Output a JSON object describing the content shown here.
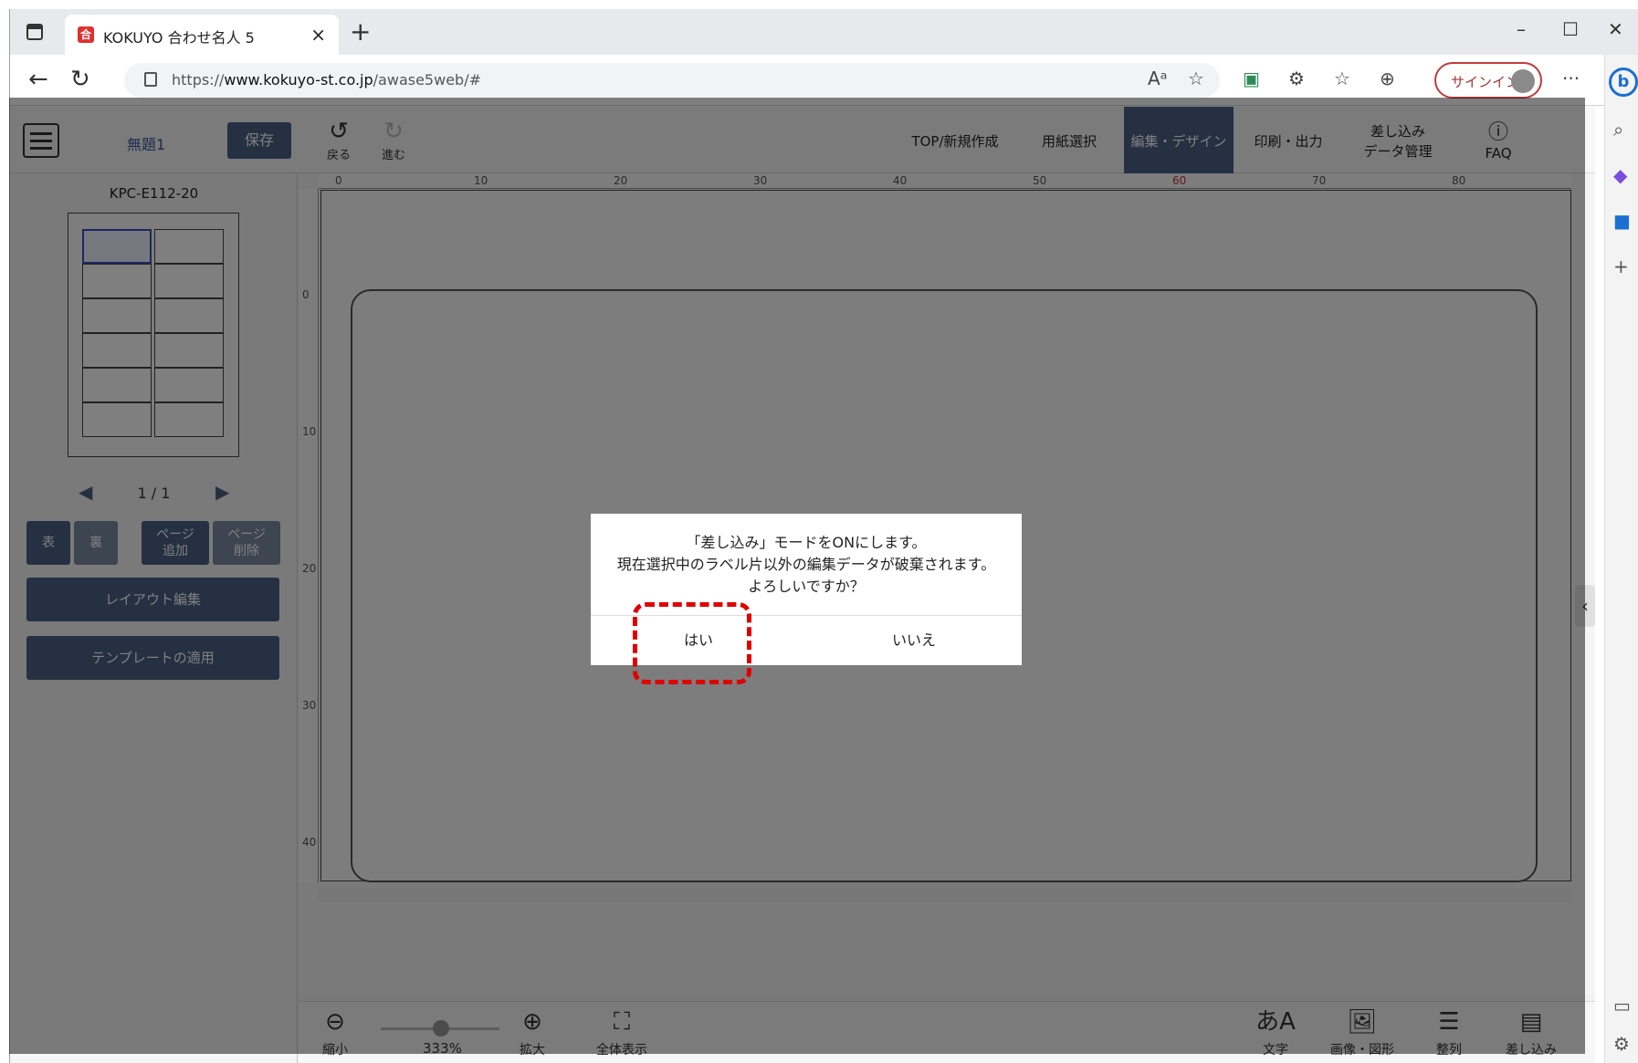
{
  "browser": {
    "tab_title": "KOKUYO 合わせ名人 5",
    "url_prefix": "https://",
    "url_host": "www.kokuyo-st.co.jp",
    "url_path": "/awase5web/#",
    "signin_label": "サインイン"
  },
  "app": {
    "doc_title": "無題1",
    "save_label": "保存",
    "undo_label": "戻る",
    "redo_label": "進む",
    "nav": [
      {
        "label": "TOP/新規作成"
      },
      {
        "label": "用紙選択"
      },
      {
        "label": "編集・デザイン"
      },
      {
        "label": "印刷・出力"
      },
      {
        "label": "差し込み\nデータ管理"
      },
      {
        "label": "FAQ"
      }
    ]
  },
  "left_panel": {
    "sheet_code": "KPC-E112-20",
    "pager": "1 / 1",
    "front_label": "表",
    "back_label": "裏",
    "add_page_label": "ページ\n追加",
    "delete_page_label": "ページ\n削除",
    "layout_edit_label": "レイアウト編集",
    "template_apply_label": "テンプレートの適用"
  },
  "rulers": {
    "top": [
      "0",
      "10",
      "20",
      "30",
      "40",
      "50",
      "60",
      "70",
      "80"
    ],
    "left": [
      "0",
      "10",
      "20",
      "30",
      "40"
    ]
  },
  "bottom_bar": {
    "zoom_out_label": "縮小",
    "zoom_value": "333%",
    "zoom_in_label": "拡大",
    "fit_label": "全体表示",
    "text_label": "文字",
    "image_label": "画像・図形",
    "align_label": "整列",
    "merge_label": "差し込み"
  },
  "dialog": {
    "line1": "「差し込み」モードをONにします。",
    "line2": "現在選択中のラベル片以外の編集データが破棄されます。",
    "line3": "よろしいですか？",
    "yes_label": "はい",
    "no_label": "いいえ"
  },
  "colors": {
    "accent": "#4a6185",
    "highlight": "#e00000"
  }
}
